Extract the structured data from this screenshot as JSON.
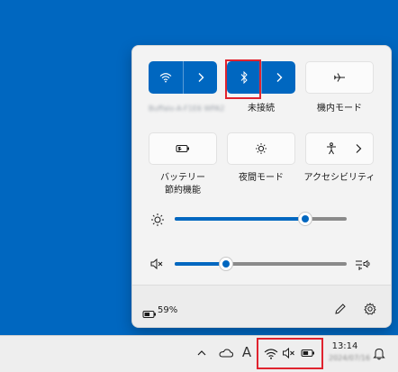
{
  "quick_settings": {
    "wifi_network_name": "Buffalo-A-F1E6 WPA2",
    "bluetooth_label": "未接続",
    "airplane_label": "機内モード",
    "battery_saver_label_line1": "バッテリー",
    "battery_saver_label_line2": "節約機能",
    "night_light_label": "夜間モード",
    "accessibility_label": "アクセシビリティ",
    "brightness_level": 0.76,
    "volume_level": 0.3,
    "battery_percent": "59%"
  },
  "taskbar": {
    "time": "13:14",
    "date": "2024/07/16",
    "ime_label": "A"
  },
  "colors": {
    "accent": "#0067c0",
    "highlight": "#e0232e"
  }
}
